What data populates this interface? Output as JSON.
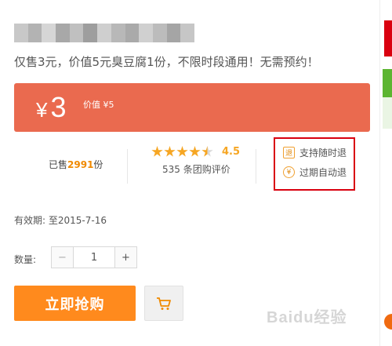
{
  "title_blurred_colors": [
    "#c8c8c8",
    "#b3b3b3",
    "#d6d6d6",
    "#a8a8a8",
    "#c0c0c0",
    "#9e9e9e",
    "#cfcfcf",
    "#b8b8b8",
    "#aaaaaa",
    "#d0d0d0",
    "#bcbcbc",
    "#a5a5a5",
    "#c6c6c6"
  ],
  "subtitle": "仅售3元，价值5元臭豆腐1份，不限时段通用！无需预约！",
  "price": {
    "currency": "¥",
    "amount": "3",
    "worth_label": "价值 ¥5"
  },
  "sales": {
    "prefix": "已售",
    "count": "2991",
    "suffix": "份"
  },
  "rating": {
    "stars": 4.5,
    "score": "4.5",
    "reviews": "535 条团购评价"
  },
  "guarantee": {
    "item1": "支持随时退",
    "item2": "过期自动退"
  },
  "validity": {
    "label": "有效期:",
    "value": "至2015-7-16"
  },
  "quantity": {
    "label": "数量:",
    "minus": "−",
    "value": "1",
    "plus": "+"
  },
  "buy_button": "立即抢购",
  "watermark": "Baidu经验",
  "colors": {
    "accent_red": "#ea6a4f",
    "buy_orange": "#ff8a1d",
    "star": "#f6a623",
    "highlight_box": "#d9000f"
  }
}
